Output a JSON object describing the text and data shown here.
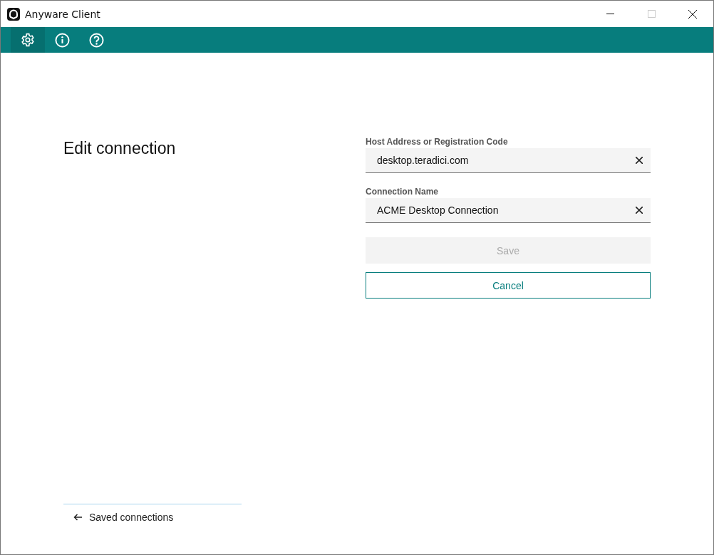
{
  "window": {
    "title": "Anyware Client",
    "maximize_disabled": true
  },
  "toolbar": [
    {
      "kind": "settings",
      "selected": true
    },
    {
      "kind": "info",
      "selected": false
    },
    {
      "kind": "help",
      "selected": false
    }
  ],
  "heading": "Edit connection",
  "fields": [
    {
      "label": "Host Address or Registration Code",
      "value": "desktop.teradici.com"
    },
    {
      "label": "Connection Name",
      "value": "ACME Desktop Connection"
    }
  ],
  "buttons": [
    {
      "label": "Save",
      "kind": "primary",
      "disabled": true
    },
    {
      "label": "Cancel",
      "kind": "outline",
      "disabled": false
    }
  ],
  "back_link": "Saved connections"
}
